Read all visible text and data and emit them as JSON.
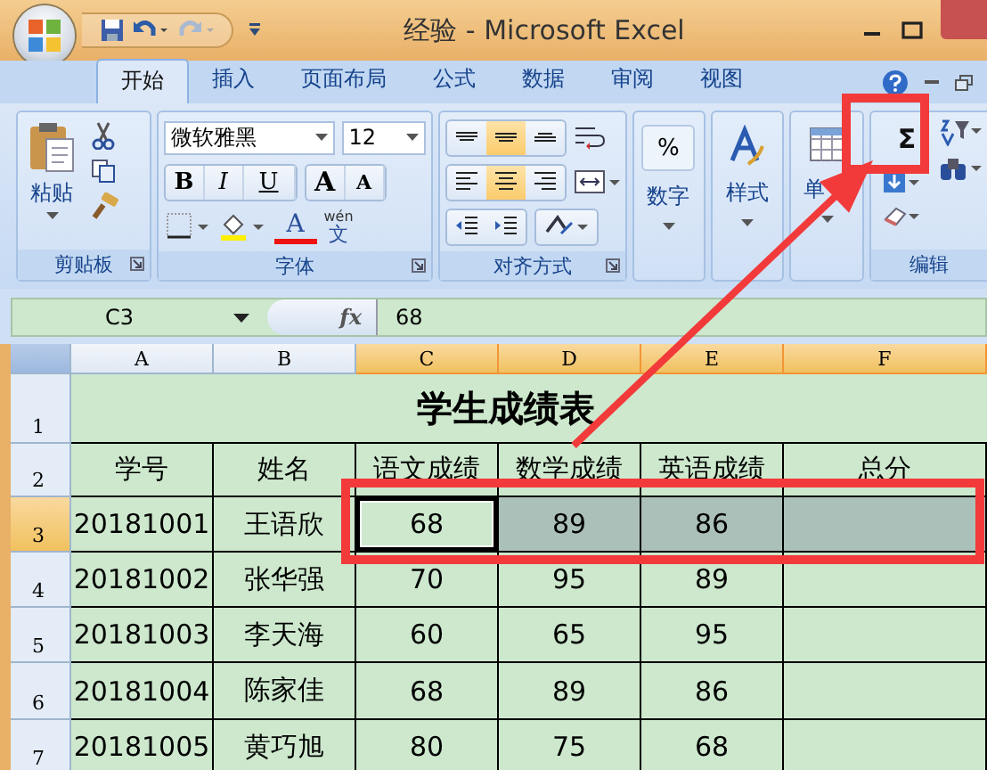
{
  "title_bar": {
    "title": "经验 - Microsoft Excel"
  },
  "tabs": [
    {
      "label": "开始",
      "selected": true
    },
    {
      "label": "插入",
      "selected": false
    },
    {
      "label": "页面布局",
      "selected": false
    },
    {
      "label": "公式",
      "selected": false
    },
    {
      "label": "数据",
      "selected": false
    },
    {
      "label": "审阅",
      "selected": false
    },
    {
      "label": "视图",
      "selected": false
    }
  ],
  "clipboard": {
    "label": "剪贴板",
    "paste": "粘贴"
  },
  "font": {
    "label": "字体",
    "name": "微软雅黑",
    "size": "12",
    "bold": "B",
    "italic": "I",
    "underline": "U",
    "grow": "A",
    "shrink": "A",
    "color_letter": "A",
    "phonetic_top": "wén",
    "phonetic": "文"
  },
  "alignment": {
    "label": "对齐方式",
    "vertical": [
      {
        "kind": "top",
        "selected": false
      },
      {
        "kind": "middle",
        "selected": true
      },
      {
        "kind": "bottom",
        "selected": false
      }
    ],
    "horizontal": [
      {
        "kind": "left",
        "selected": false
      },
      {
        "kind": "center",
        "selected": true
      },
      {
        "kind": "right",
        "selected": false
      }
    ]
  },
  "number": {
    "label": "数字",
    "symbol": "%"
  },
  "styles": {
    "label": "样式"
  },
  "cells": {
    "label": "单"
  },
  "editing": {
    "label": "编辑",
    "sum": "Σ"
  },
  "formula_bar": {
    "name_box": "C3",
    "function_label": "fx",
    "value": "68"
  },
  "sheet": {
    "columns": [
      {
        "label": "A",
        "selected": false
      },
      {
        "label": "B",
        "selected": false
      },
      {
        "label": "C",
        "selected": true
      },
      {
        "label": "D",
        "selected": true
      },
      {
        "label": "E",
        "selected": true
      },
      {
        "label": "F",
        "selected": true
      }
    ],
    "title": {
      "number": "1",
      "text": "学生成绩表"
    },
    "header": {
      "number": "2",
      "cells": [
        "学号",
        "姓名",
        "语文成绩",
        "数学成绩",
        "英语成绩",
        "总分"
      ]
    },
    "rows": [
      {
        "number": "3",
        "selected": true,
        "cells": [
          {
            "text": "20181001",
            "selected": false
          },
          {
            "text": "王语欣",
            "selected": false
          },
          {
            "text": "68",
            "selected": true
          },
          {
            "text": "89",
            "selected": true
          },
          {
            "text": "86",
            "selected": true
          },
          {
            "selected": true
          }
        ]
      },
      {
        "number": "4",
        "selected": false,
        "cells": [
          {
            "text": "20181002",
            "selected": false
          },
          {
            "text": "张华强",
            "selected": false
          },
          {
            "text": "70",
            "selected": false
          },
          {
            "text": "95",
            "selected": false
          },
          {
            "text": "89",
            "selected": false
          },
          {
            "selected": false
          }
        ]
      },
      {
        "number": "5",
        "selected": false,
        "cells": [
          {
            "text": "20181003",
            "selected": false
          },
          {
            "text": "李天海",
            "selected": false
          },
          {
            "text": "60",
            "selected": false
          },
          {
            "text": "65",
            "selected": false
          },
          {
            "text": "95",
            "selected": false
          },
          {
            "selected": false
          }
        ]
      },
      {
        "number": "6",
        "selected": false,
        "cells": [
          {
            "text": "20181004",
            "selected": false
          },
          {
            "text": "陈家佳",
            "selected": false
          },
          {
            "text": "68",
            "selected": false
          },
          {
            "text": "89",
            "selected": false
          },
          {
            "text": "86",
            "selected": false
          },
          {
            "selected": false
          }
        ]
      },
      {
        "number": "7",
        "selected": false,
        "cells": [
          {
            "text": "20181005",
            "selected": false
          },
          {
            "text": "黄巧旭",
            "selected": false
          },
          {
            "text": "80",
            "selected": false
          },
          {
            "text": "75",
            "selected": false
          },
          {
            "text": "68",
            "selected": false
          },
          {
            "selected": false
          }
        ]
      }
    ]
  },
  "annotations": [
    {
      "kind": "frame"
    },
    {
      "kind": "frame"
    },
    {
      "kind": "arrow"
    }
  ]
}
